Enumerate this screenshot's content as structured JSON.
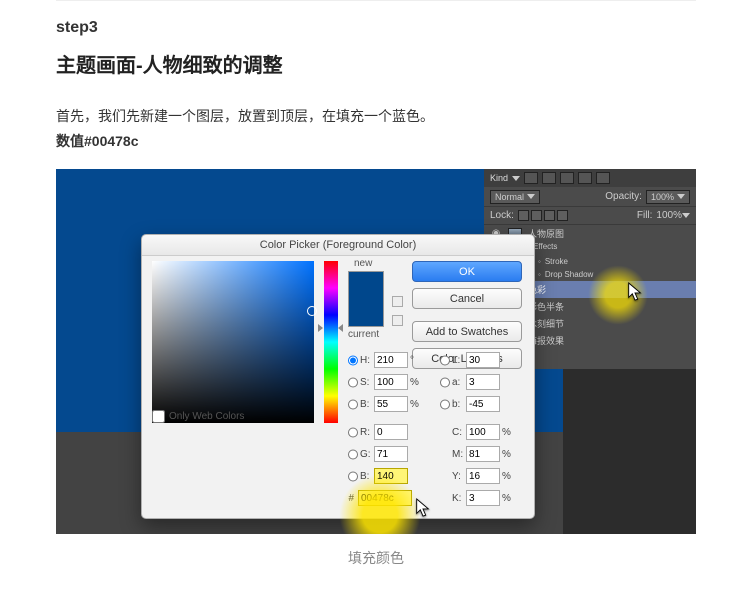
{
  "article": {
    "step_label": "step3",
    "title": "主题画面-人物细致的调整",
    "desc": "首先，我们先新建一个图层，放置到顶层，在填充一个蓝色。",
    "hex_line": "数值#00478c",
    "caption": "填充颜色"
  },
  "picker": {
    "title": "Color Picker (Foreground Color)",
    "new_label": "new",
    "current_label": "current",
    "only_web": "Only Web Colors",
    "buttons": {
      "ok": "OK",
      "cancel": "Cancel",
      "swatches": "Add to Swatches",
      "libraries": "Color Libraries"
    },
    "hsb": {
      "h_label": "H:",
      "h": "210",
      "h_unit": "°",
      "s_label": "S:",
      "s": "100",
      "s_unit": "%",
      "b_label": "B:",
      "b": "55",
      "b_unit": "%"
    },
    "lab": {
      "l_label": "L:",
      "l": "30",
      "a_label": "a:",
      "a": "3",
      "b_label": "b:",
      "b": "-45"
    },
    "rgb": {
      "r_label": "R:",
      "r": "0",
      "g_label": "G:",
      "g": "71",
      "b_label": "B:",
      "b": "140"
    },
    "cmyk": {
      "c_label": "C:",
      "c": "100",
      "c_unit": "%",
      "m_label": "M:",
      "m": "81",
      "m_unit": "%",
      "y_label": "Y:",
      "y": "16",
      "y_unit": "%",
      "k_label": "K:",
      "k": "3",
      "k_unit": "%"
    },
    "hex_hash": "#",
    "hex": "00478c"
  },
  "panel": {
    "kind": "Kind",
    "blend": "Normal",
    "opacity_label": "Opacity:",
    "opacity": "100%",
    "lock_label": "Lock:",
    "fill_label": "Fill:",
    "fill": "100%",
    "effects": "Effects",
    "stroke": "Stroke",
    "dropshadow": "Drop Shadow",
    "layers": [
      {
        "name": "人物原图"
      },
      {
        "name": "色彩"
      },
      {
        "name": "彩色半条"
      },
      {
        "name": "木刻细节"
      },
      {
        "name": "海报效果"
      }
    ]
  }
}
